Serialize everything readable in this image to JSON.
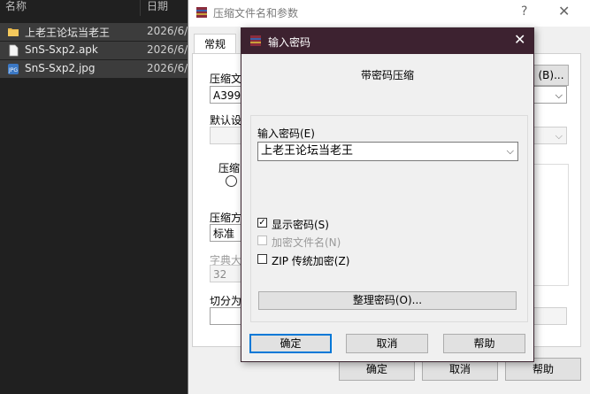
{
  "explorer": {
    "col_name": "名称",
    "col_date": "日期",
    "files": [
      {
        "name": "上老王论坛当老王",
        "date": "2026/6/",
        "icon": "folder-icon"
      },
      {
        "name": "SnS-Sxp2.apk",
        "date": "2026/6/",
        "icon": "file-icon"
      },
      {
        "name": "SnS-Sxp2.jpg",
        "date": "2026/6/",
        "icon": "jpg-image-icon"
      }
    ]
  },
  "archive_dialog": {
    "title": "压缩文件名和参数",
    "help": "?",
    "close": "✕",
    "tab_general": "常规",
    "archive_name_label": "压缩文",
    "archive_name_value": "A3998",
    "browse_button": "(B)...",
    "default_settings_label": "默认设",
    "format_label": "压缩",
    "method_label": "压缩方",
    "method_value": "标准",
    "dict_label": "字典大",
    "dict_value": "32",
    "split_label": "切分为",
    "ok": "确定",
    "cancel": "取消",
    "help_btn": "帮助"
  },
  "password_dialog": {
    "title": "输入密码",
    "close": "✕",
    "subtitle": "带密码压缩",
    "pw_label": "输入密码(E)",
    "pw_value": "上老王论坛当老王",
    "show_password": "显示密码(S)",
    "show_password_checked": true,
    "encrypt_names": "加密文件名(N)",
    "encrypt_names_checked": false,
    "zip_legacy": "ZIP 传统加密(Z)",
    "zip_legacy_checked": false,
    "organize": "整理密码(O)...",
    "ok": "确定",
    "cancel": "取消",
    "help": "帮助"
  },
  "colors": {
    "title_bar": "#3d2230",
    "default_button_border": "#0078d7",
    "explorer_bg": "#202020"
  }
}
